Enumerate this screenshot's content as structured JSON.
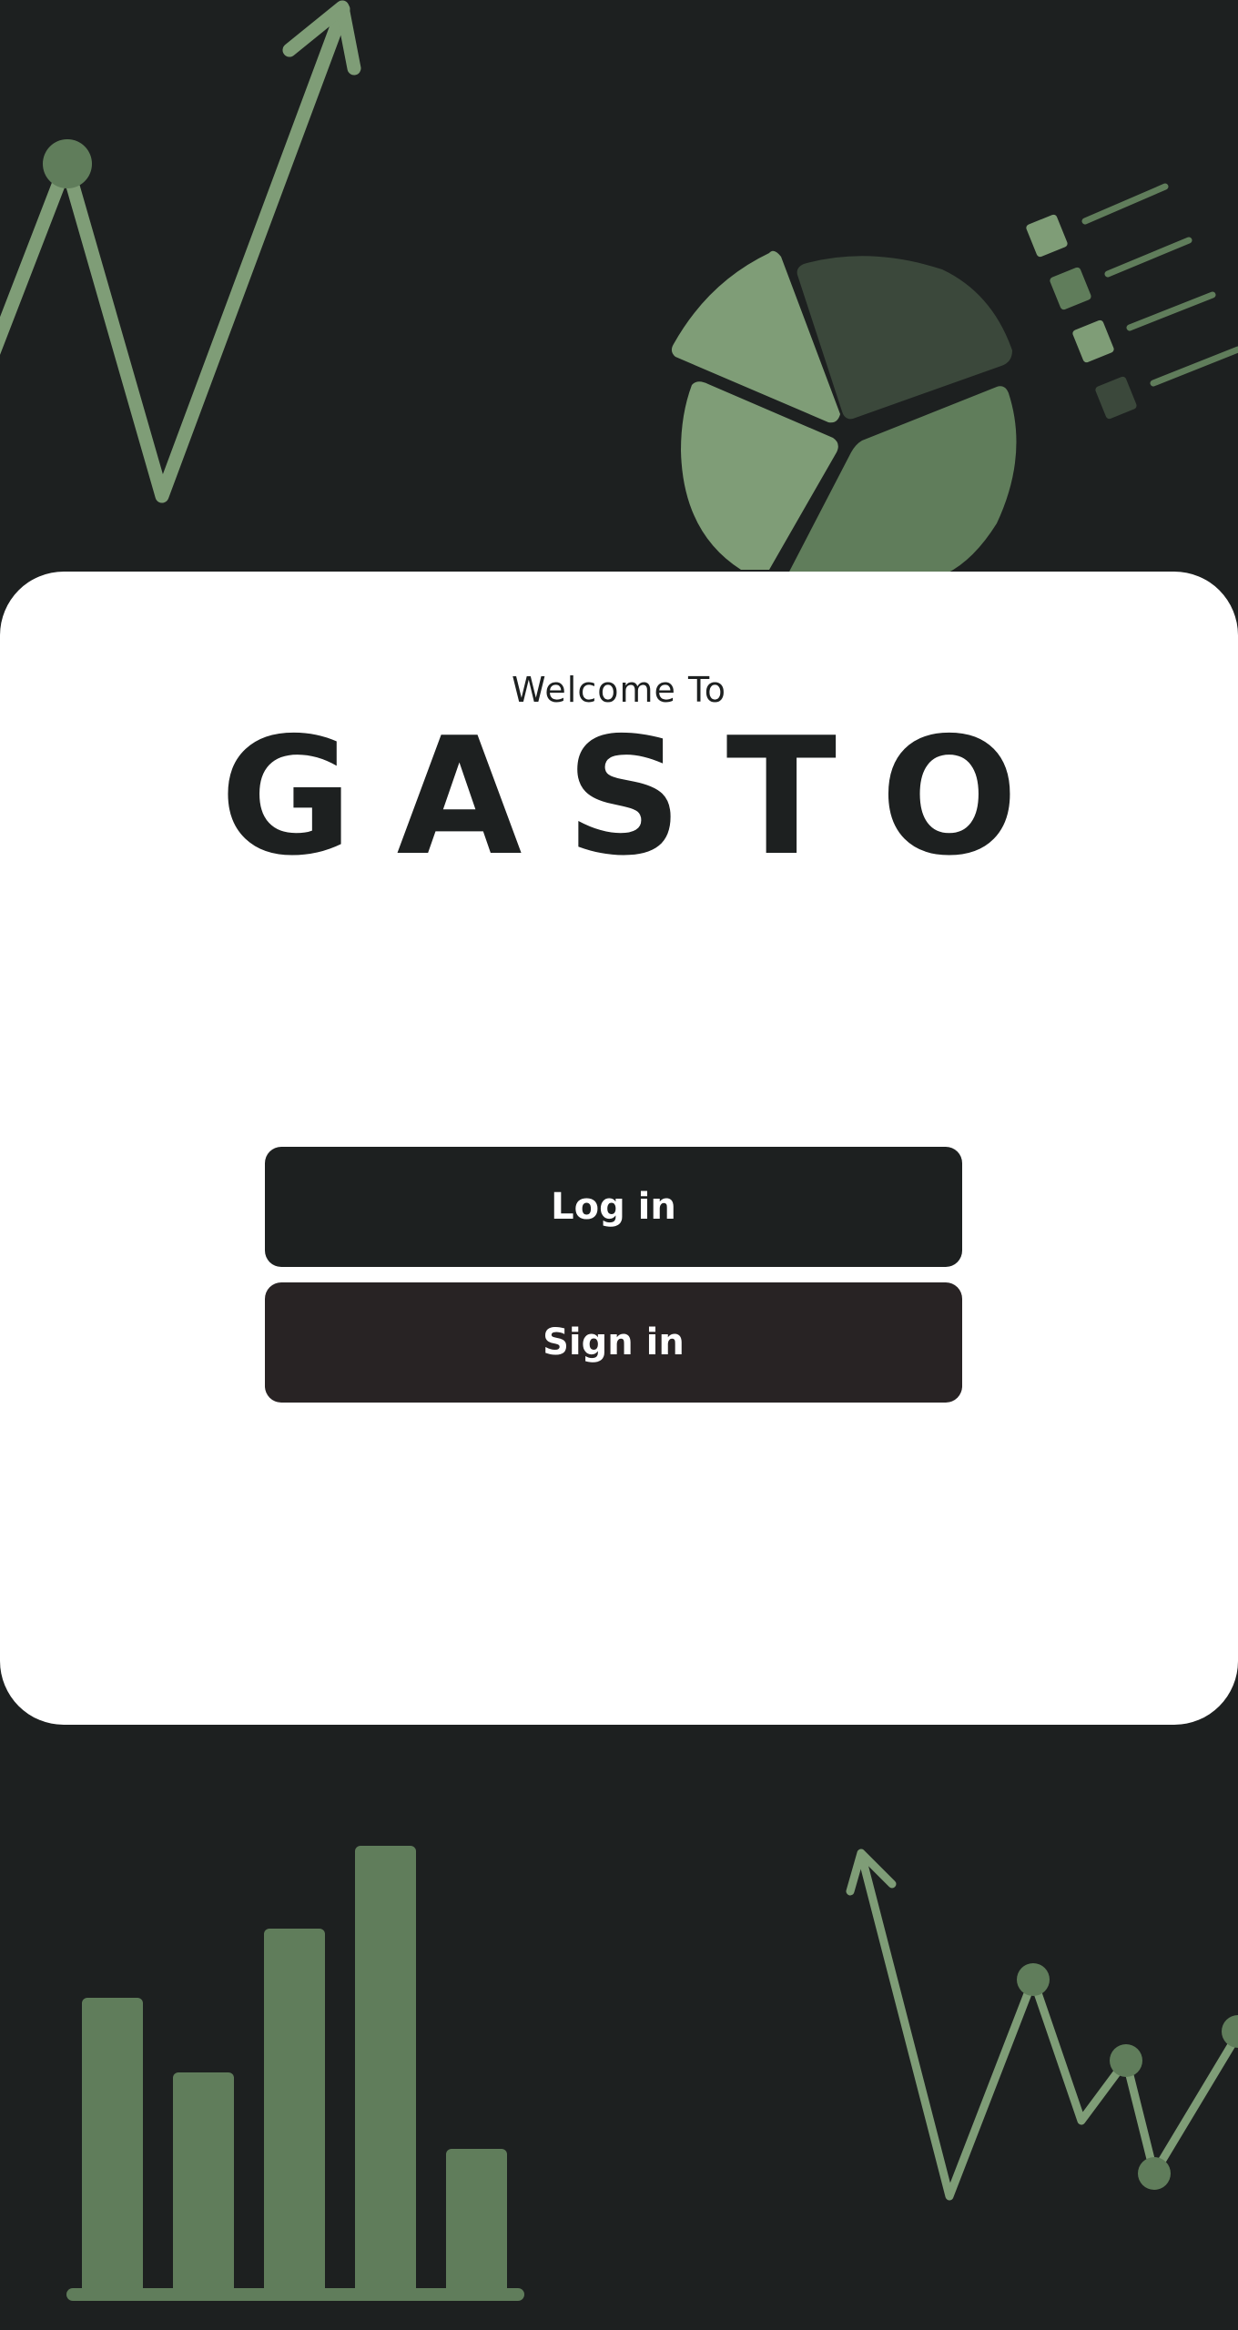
{
  "app": {
    "welcome_text": "Welcome To",
    "brand_name": "GASTO"
  },
  "actions": {
    "login_label": "Log in",
    "signin_label": "Sign in"
  },
  "colors": {
    "background": "#1d2020",
    "card": "#ffffff",
    "accent_light": "#7f9d77",
    "accent_mid": "#607d5b",
    "accent_dark": "#3b483b",
    "login_button": "#1d2020",
    "signin_button": "#282324"
  },
  "icons": {
    "top_left": "line-chart-up-arrow-icon",
    "top_right_pie": "pie-chart-icon",
    "top_right_legend": "legend-list-icon",
    "bottom_left": "bar-chart-icon",
    "bottom_right": "line-chart-icon"
  }
}
